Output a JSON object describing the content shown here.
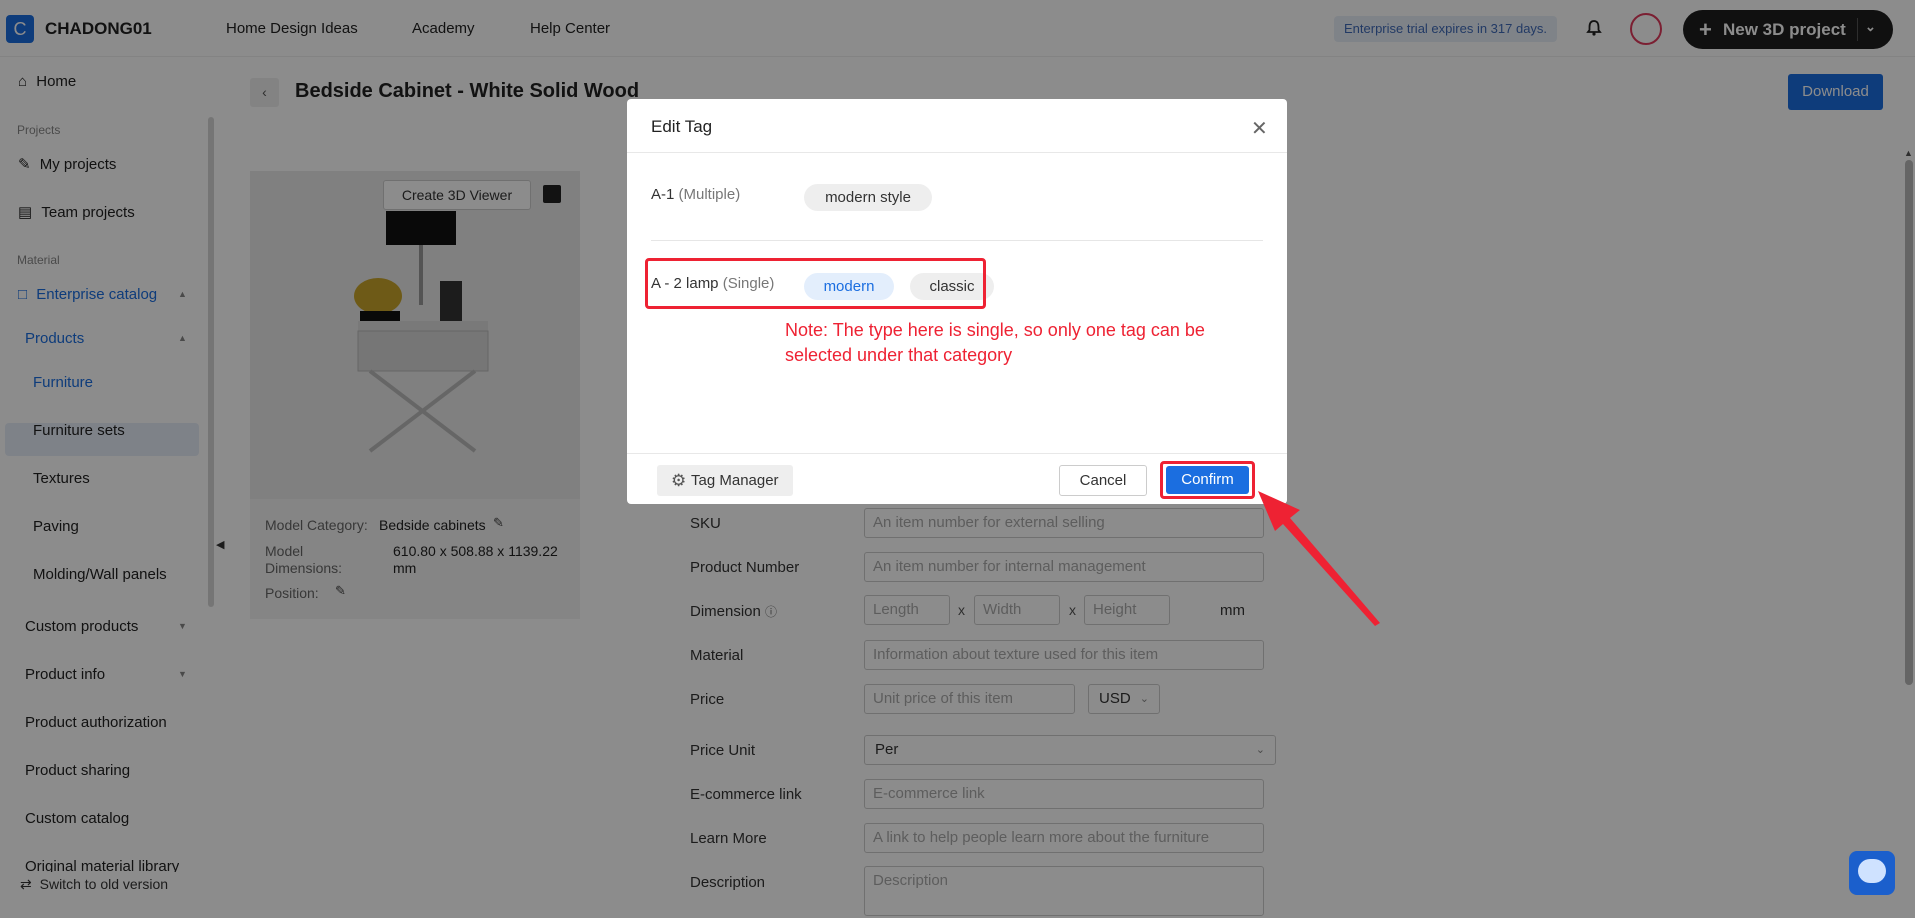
{
  "header": {
    "logo_letter": "C",
    "brand": "CHADONG01",
    "nav": [
      "Home Design Ideas",
      "Academy",
      "Help Center"
    ],
    "trial_notice": "Enterprise trial expires in 317 days.",
    "new_project_label": "New 3D project"
  },
  "sidebar": {
    "home": "Home",
    "section_projects": "Projects",
    "my_projects": "My projects",
    "team_projects": "Team projects",
    "section_material": "Material",
    "enterprise_catalog": "Enterprise catalog",
    "products": "Products",
    "items": [
      "Furniture",
      "Furniture sets",
      "Textures",
      "Paving",
      "Molding/Wall panels"
    ],
    "custom_products": "Custom products",
    "product_info": "Product info",
    "product_authorization": "Product authorization",
    "product_sharing": "Product sharing",
    "custom_catalog": "Custom catalog",
    "original_material_library": "Original material library",
    "switch_old": "Switch to old version"
  },
  "page": {
    "title": "Bedside Cabinet - White Solid Wood",
    "download": "Download",
    "create_3d_viewer": "Create 3D Viewer",
    "model_category_label": "Model Category:",
    "model_category_value": "Bedside cabinets",
    "model_dimensions_label_1": "Model",
    "model_dimensions_label_2": "Dimensions:",
    "model_dimensions_value_1": "610.80 x 508.88 x 1139.22",
    "model_dimensions_value_2": "mm",
    "position_label": "Position:"
  },
  "form": {
    "sku_label": "SKU",
    "sku_placeholder": "An item number for external selling",
    "product_number_label": "Product Number",
    "product_number_placeholder": "An item number for internal management",
    "dimension_label": "Dimension",
    "length_placeholder": "Length",
    "width_placeholder": "Width",
    "height_placeholder": "Height",
    "dim_sep": "x",
    "dim_unit": "mm",
    "material_label": "Material",
    "material_placeholder": "Information about texture used for this item",
    "price_label": "Price",
    "price_placeholder": "Unit price of this item",
    "currency": "USD",
    "price_unit_label": "Price Unit",
    "price_unit_value": "Per",
    "ecommerce_label": "E-commerce link",
    "ecommerce_placeholder": "E-commerce link",
    "learn_more_label": "Learn More",
    "learn_more_placeholder": "A link to help people learn more about the furniture",
    "description_label": "Description",
    "description_placeholder": "Description"
  },
  "modal": {
    "title": "Edit Tag",
    "cat1_name": "A-1",
    "cat1_type": "(Multiple)",
    "cat1_tags": [
      "modern style"
    ],
    "cat2_name": "A - 2 lamp",
    "cat2_type": "(Single)",
    "cat2_tags": [
      "modern",
      "classic"
    ],
    "cat2_selected": "modern",
    "note": "Note: The type here is single, so only one tag can be selected under that category",
    "tag_manager": "Tag Manager",
    "cancel": "Cancel",
    "confirm": "Confirm"
  },
  "colors": {
    "accent": "#1b6ee0",
    "annotation_red": "#ee2233",
    "overlay": "rgba(0,0,0,0.45)"
  }
}
